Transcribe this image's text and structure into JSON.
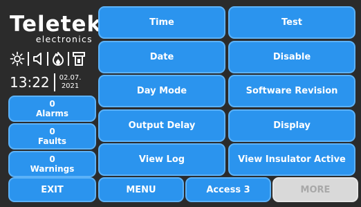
{
  "logo": {
    "brand": "Teletek",
    "sub": "electronics"
  },
  "clock": {
    "time": "13:22",
    "date_day_month": "02.07.",
    "date_year": "2021"
  },
  "status_icons": [
    "sun-icon",
    "speaker-icon",
    "flame-icon",
    "tower-icon"
  ],
  "status": {
    "alarms": {
      "count": "0",
      "label": "Alarms"
    },
    "faults": {
      "count": "0",
      "label": "Faults"
    },
    "warnings": {
      "count": "0",
      "label": "Warnings"
    }
  },
  "menu": {
    "time": "Time",
    "test": "Test",
    "date": "Date",
    "disable": "Disable",
    "day_mode": "Day Mode",
    "software_revision": "Software Revision",
    "output_delay": "Output Delay",
    "display": "Display",
    "view_log": "View Log",
    "view_insulator_active": "View Insulator Active"
  },
  "bottom": {
    "exit": "EXIT",
    "menu": "MENU",
    "access": "Access 3",
    "more": "MORE"
  },
  "colors": {
    "button": "#2b94ee",
    "button_border": "#5cb2f8",
    "background": "#2b2b2b",
    "disabled": "#d9d9d9"
  }
}
